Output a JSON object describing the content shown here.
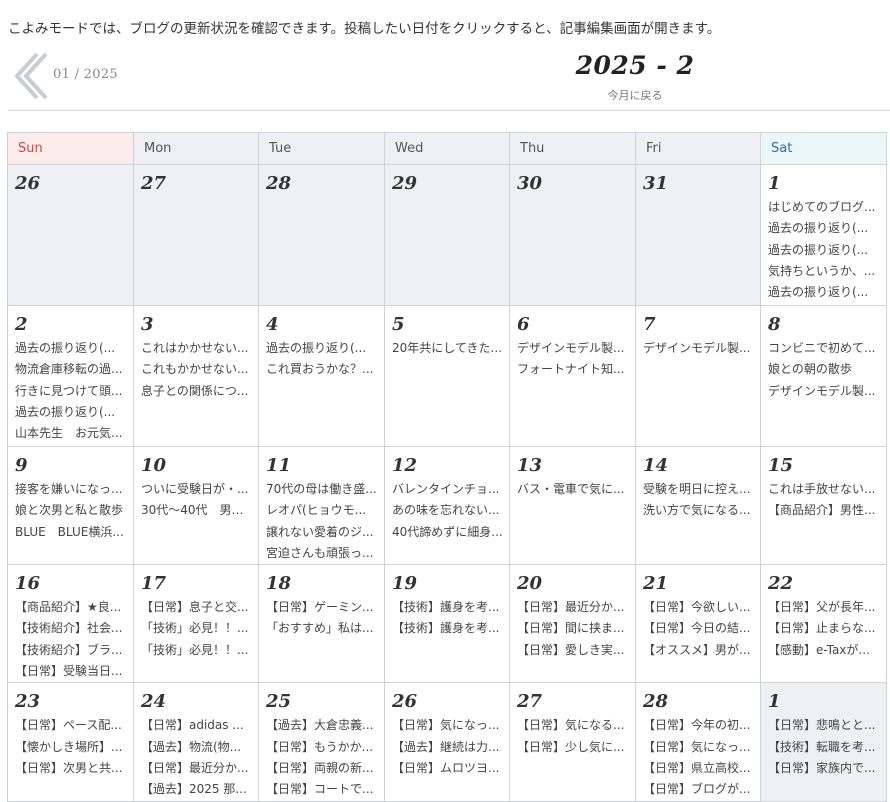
{
  "intro": "こよみモードでは、ブログの更新状況を確認できます。投稿したい日付をクリックすると、記事編集画面が開きます。",
  "nav": {
    "prev_label": "01 / 2025",
    "month_title": "2025 - 2",
    "today_link": "今月に戻る"
  },
  "weekdays": [
    "Sun",
    "Mon",
    "Tue",
    "Wed",
    "Thu",
    "Fri",
    "Sat"
  ],
  "weeks": [
    [
      {
        "day": "26",
        "other": true,
        "entries": []
      },
      {
        "day": "27",
        "other": true,
        "entries": []
      },
      {
        "day": "28",
        "other": true,
        "entries": []
      },
      {
        "day": "29",
        "other": true,
        "entries": []
      },
      {
        "day": "30",
        "other": true,
        "entries": []
      },
      {
        "day": "31",
        "other": true,
        "entries": []
      },
      {
        "day": "1",
        "other": false,
        "entries": [
          "はじめてのブログ...",
          "過去の振り返り(...",
          "過去の振り返り(...",
          "気持ちというか、...",
          "過去の振り返り(..."
        ]
      }
    ],
    [
      {
        "day": "2",
        "other": false,
        "entries": [
          "過去の振り返り(...",
          "物流倉庫移転の過...",
          "行きに見つけて頭...",
          "過去の振り返り(...",
          "山本先生　お元気..."
        ]
      },
      {
        "day": "3",
        "other": false,
        "entries": [
          "これはかかせない...",
          "これもかかせない...",
          "息子との関係につ..."
        ]
      },
      {
        "day": "4",
        "other": false,
        "entries": [
          "過去の振り返り(...",
          "これ買おうかな？..."
        ]
      },
      {
        "day": "5",
        "other": false,
        "entries": [
          "20年共にしてきた..."
        ]
      },
      {
        "day": "6",
        "other": false,
        "entries": [
          "デザインモデル製...",
          "フォートナイト知..."
        ]
      },
      {
        "day": "7",
        "other": false,
        "entries": [
          "デザインモデル製..."
        ]
      },
      {
        "day": "8",
        "other": false,
        "entries": [
          "コンビニで初めて...",
          "娘との朝の散歩",
          "デザインモデル製..."
        ]
      }
    ],
    [
      {
        "day": "9",
        "other": false,
        "entries": [
          "接客を嫌いになっ...",
          "娘と次男と私と散歩",
          "BLUE　BLUE横浜..."
        ]
      },
      {
        "day": "10",
        "other": false,
        "entries": [
          "ついに受験日が・...",
          "30代～40代　男性..."
        ]
      },
      {
        "day": "11",
        "other": false,
        "entries": [
          "70代の母は働き盛...",
          "レオパ(ヒョウモ...",
          "譲れない愛着のジ...",
          "宮迫さんも頑張っ..."
        ]
      },
      {
        "day": "12",
        "other": false,
        "entries": [
          "バレンタインチョ...",
          "あの味を忘れない...",
          "40代諦めずに細身..."
        ]
      },
      {
        "day": "13",
        "other": false,
        "entries": [
          "バス・電車で気に..."
        ]
      },
      {
        "day": "14",
        "other": false,
        "entries": [
          "受験を明日に控え...",
          "洗い方で気になる..."
        ]
      },
      {
        "day": "15",
        "other": false,
        "entries": [
          "これは手放せない...",
          "【商品紹介】男性..."
        ]
      }
    ],
    [
      {
        "day": "16",
        "other": false,
        "entries": [
          "【商品紹介】★良...",
          "【技術紹介】社会...",
          "【技術紹介】ブラ...",
          "【日常】受験当日..."
        ]
      },
      {
        "day": "17",
        "other": false,
        "entries": [
          "【日常】息子と交...",
          "「技術」必見！！...",
          "「技術」必見！！..."
        ]
      },
      {
        "day": "18",
        "other": false,
        "entries": [
          "【日常】ゲーミン...",
          "「おすすめ」私は..."
        ]
      },
      {
        "day": "19",
        "other": false,
        "entries": [
          "【技術】護身を考...",
          "【技術】護身を考..."
        ]
      },
      {
        "day": "20",
        "other": false,
        "entries": [
          "【日常】最近分か...",
          "【日常】間に挟ま...",
          "【日常】愛しき実..."
        ]
      },
      {
        "day": "21",
        "other": false,
        "entries": [
          "【日常】今欲しい...",
          "【日常】今日の結...",
          "【オススメ】男が..."
        ]
      },
      {
        "day": "22",
        "other": false,
        "entries": [
          "【日常】父が長年...",
          "【日常】止まらな...",
          "【感動】e-Taxが..."
        ]
      }
    ],
    [
      {
        "day": "23",
        "other": false,
        "entries": [
          "【日常】ペース配...",
          "【懐かしき場所】...",
          "【日常】次男と共..."
        ]
      },
      {
        "day": "24",
        "other": false,
        "entries": [
          "【日常】adidas ...",
          "【過去】物流(物...",
          "【日常】最近分か...",
          "【過去】2025 那..."
        ]
      },
      {
        "day": "25",
        "other": false,
        "entries": [
          "【過去】大倉忠義...",
          "【日常】もうかか...",
          "【日常】両親の新...",
          "【日常】コートで..."
        ]
      },
      {
        "day": "26",
        "other": false,
        "entries": [
          "【日常】気になっ...",
          "【過去】継続は力...",
          "【日常】ムロツヨ..."
        ]
      },
      {
        "day": "27",
        "other": false,
        "entries": [
          "【日常】気になる...",
          "【日常】少し気に..."
        ]
      },
      {
        "day": "28",
        "other": false,
        "entries": [
          "【日常】今年の初...",
          "【日常】気になっ...",
          "【日常】県立高校...",
          "【日常】ブログが..."
        ]
      },
      {
        "day": "1",
        "other": true,
        "entries": [
          "【日常】悲鳴とと...",
          "【技術】転職を考...",
          "【日常】家族内で..."
        ]
      }
    ]
  ]
}
